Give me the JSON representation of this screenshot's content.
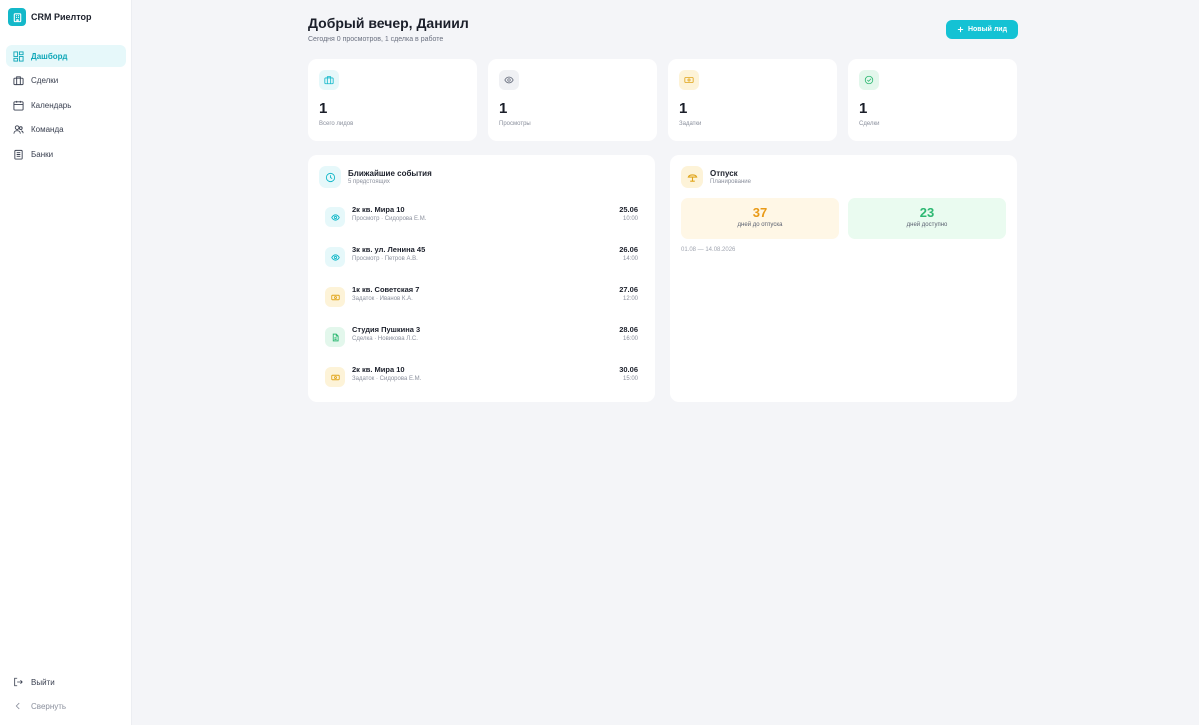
{
  "brand": {
    "title": "CRM Риелтор",
    "icon": "building-icon"
  },
  "sidebar": {
    "items": [
      {
        "label": "Дашборд",
        "icon": "dashboard-icon",
        "active": true
      },
      {
        "label": "Сделки",
        "icon": "briefcase-icon",
        "active": false
      },
      {
        "label": "Календарь",
        "icon": "calendar-icon",
        "active": false
      },
      {
        "label": "Команда",
        "icon": "users-icon",
        "active": false
      },
      {
        "label": "Банки",
        "icon": "bank-icon",
        "active": false
      }
    ],
    "logout_label": "Выйти",
    "collapse_label": "Свернуть"
  },
  "header": {
    "greeting": "Добрый вечер, Даниил",
    "subtitle": "Сегодня 0 просмотров, 1 сделка в работе",
    "new_lead_label": "Новый лид"
  },
  "stats": [
    {
      "value": "1",
      "label": "Всего лидов",
      "icon": "briefcase-icon",
      "color": "#14b8c9",
      "bg": "#e6f8fa"
    },
    {
      "value": "1",
      "label": "Просмотры",
      "icon": "eye-icon",
      "color": "#6b7180",
      "bg": "#f0f1f4"
    },
    {
      "value": "1",
      "label": "Задатки",
      "icon": "cash-icon",
      "color": "#e0a419",
      "bg": "#fdf3d8"
    },
    {
      "value": "1",
      "label": "Сделки",
      "icon": "check-circle-icon",
      "color": "#2db872",
      "bg": "#e3f7ec"
    }
  ],
  "events": {
    "title": "Ближайшие события",
    "subtitle": "5 предстоящих",
    "items": [
      {
        "title": "2к кв. Мира 10",
        "meta": "Просмотр · Сидорова Е.М.",
        "date": "25.06",
        "time": "10:00",
        "icon": "eye-icon"
      },
      {
        "title": "3к кв. ул. Ленина 45",
        "meta": "Просмотр · Петров А.В.",
        "date": "26.06",
        "time": "14:00",
        "icon": "eye-icon"
      },
      {
        "title": "1к кв. Советская 7",
        "meta": "Задаток · Иванов К.А.",
        "date": "27.06",
        "time": "12:00",
        "icon": "cash-icon"
      },
      {
        "title": "Студия Пушкина 3",
        "meta": "Сделка · Новикова Л.С.",
        "date": "28.06",
        "time": "16:00",
        "icon": "document-icon"
      },
      {
        "title": "2к кв. Мира 10",
        "meta": "Задаток · Сидорова Е.М.",
        "date": "30.06",
        "time": "15:00",
        "icon": "cash-icon"
      }
    ]
  },
  "vacation": {
    "title": "Отпуск",
    "subtitle": "Планирование",
    "days_until": "37",
    "days_until_label": "дней до отпуска",
    "days_available": "23",
    "days_available_label": "дней доступно",
    "range": "01.08 — 14.08.2026"
  }
}
